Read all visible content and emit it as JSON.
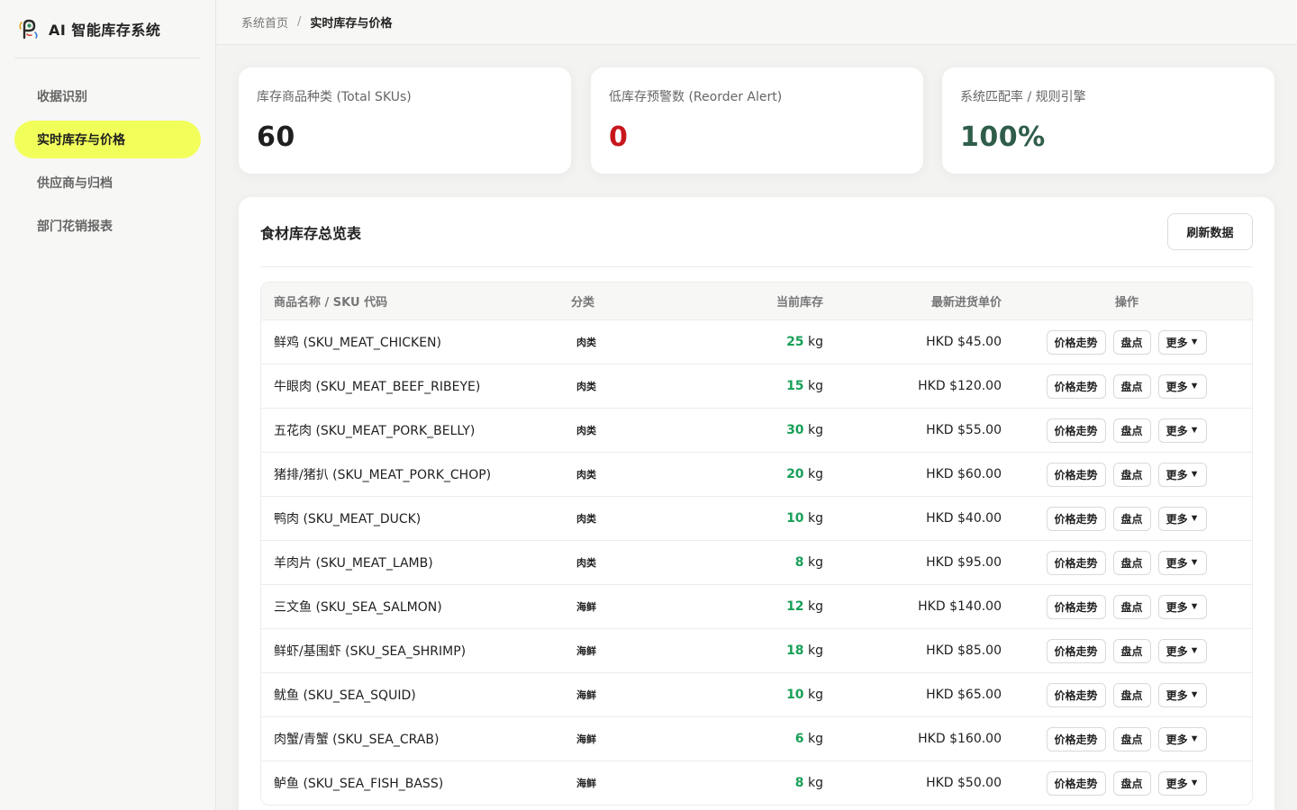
{
  "app": {
    "title": "AI 智能库存系统",
    "logo_icon": "peacock-logo-icon"
  },
  "sidebar": {
    "items": [
      {
        "label": "收据识别",
        "active": false
      },
      {
        "label": "实时库存与价格",
        "active": true
      },
      {
        "label": "供应商与归档",
        "active": false
      },
      {
        "label": "部门花销报表",
        "active": false
      }
    ]
  },
  "breadcrumb": {
    "home": "系统首页",
    "separator": "/",
    "current": "实时库存与价格"
  },
  "stats": [
    {
      "label": "库存商品种类 (Total SKUs)",
      "value": "60",
      "color": "#1f1f1f"
    },
    {
      "label": "低库存预警数 (Reorder Alert)",
      "value": "0",
      "color": "#c8161d"
    },
    {
      "label": "系统匹配率 / 规则引擎",
      "value": "100%",
      "color": "#2f5d4a"
    }
  ],
  "panel": {
    "title": "食材库存总览表",
    "refresh_label": "刷新数据"
  },
  "table": {
    "headers": {
      "name": "商品名称 / SKU 代码",
      "category": "分类",
      "stock": "当前库存",
      "price": "最新进货单价",
      "ops": "操作"
    },
    "actions": {
      "trend": "价格走势",
      "count": "盘点",
      "more": "更多",
      "more_icon": "▼"
    },
    "rows": [
      {
        "name": "鲜鸡 (SKU_MEAT_CHICKEN)",
        "category": "肉类",
        "qty": "25",
        "unit": "kg",
        "price": "HKD $45.00"
      },
      {
        "name": "牛眼肉 (SKU_MEAT_BEEF_RIBEYE)",
        "category": "肉类",
        "qty": "15",
        "unit": "kg",
        "price": "HKD $120.00"
      },
      {
        "name": "五花肉 (SKU_MEAT_PORK_BELLY)",
        "category": "肉类",
        "qty": "30",
        "unit": "kg",
        "price": "HKD $55.00"
      },
      {
        "name": "猪排/猪扒 (SKU_MEAT_PORK_CHOP)",
        "category": "肉类",
        "qty": "20",
        "unit": "kg",
        "price": "HKD $60.00"
      },
      {
        "name": "鸭肉 (SKU_MEAT_DUCK)",
        "category": "肉类",
        "qty": "10",
        "unit": "kg",
        "price": "HKD $40.00"
      },
      {
        "name": "羊肉片 (SKU_MEAT_LAMB)",
        "category": "肉类",
        "qty": "8",
        "unit": "kg",
        "price": "HKD $95.00"
      },
      {
        "name": "三文鱼 (SKU_SEA_SALMON)",
        "category": "海鲜",
        "qty": "12",
        "unit": "kg",
        "price": "HKD $140.00"
      },
      {
        "name": "鲜虾/基围虾 (SKU_SEA_SHRIMP)",
        "category": "海鲜",
        "qty": "18",
        "unit": "kg",
        "price": "HKD $85.00"
      },
      {
        "name": "鱿鱼 (SKU_SEA_SQUID)",
        "category": "海鲜",
        "qty": "10",
        "unit": "kg",
        "price": "HKD $65.00"
      },
      {
        "name": "肉蟹/青蟹 (SKU_SEA_CRAB)",
        "category": "海鲜",
        "qty": "6",
        "unit": "kg",
        "price": "HKD $160.00"
      },
      {
        "name": "鲈鱼 (SKU_SEA_FISH_BASS)",
        "category": "海鲜",
        "qty": "8",
        "unit": "kg",
        "price": "HKD $50.00"
      }
    ]
  }
}
